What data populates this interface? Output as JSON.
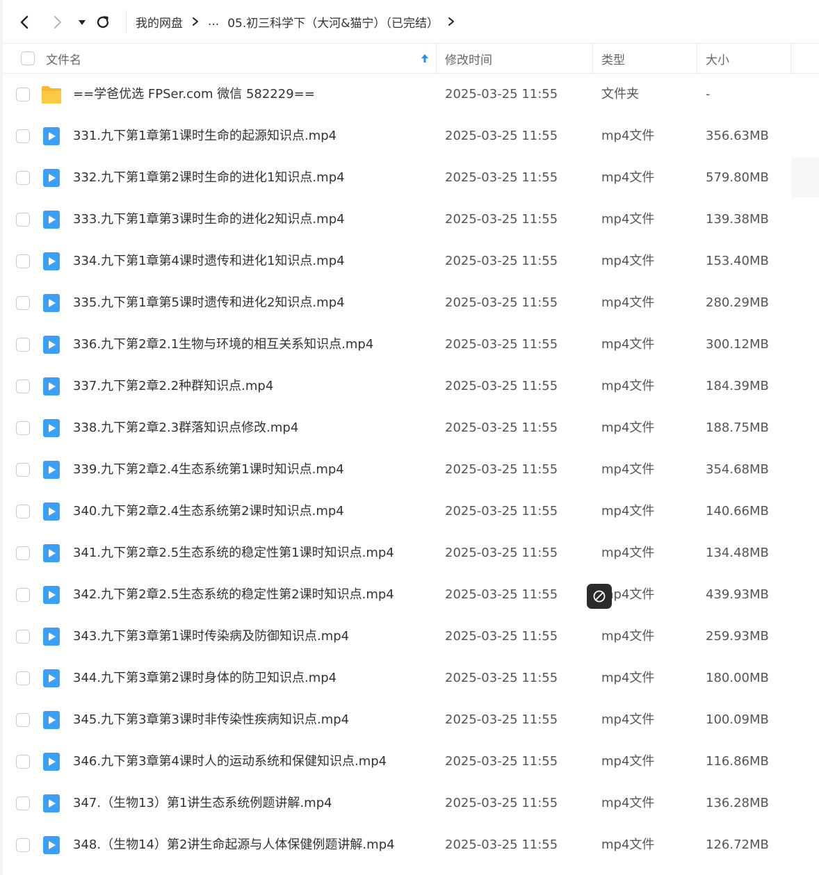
{
  "toolbar": {
    "back_icon": "chevron-left-icon",
    "forward_icon": "chevron-right-icon",
    "dropdown_icon": "caret-down-icon",
    "refresh_icon": "refresh-icon"
  },
  "breadcrumb": {
    "root": "我的网盘",
    "ellipsis": "...",
    "current": "05.初三科学下（大河&猫宁）（已完结）"
  },
  "header": {
    "name": "文件名",
    "time": "修改时间",
    "type": "类型",
    "size": "大小",
    "sort_icon": "arrow-up-icon"
  },
  "colors": {
    "accent": "#1e90ff",
    "folder": "#fbc53e",
    "video": "#3aa0f5"
  },
  "files": [
    {
      "name": "==学爸优选 FPSer.com 微信 582229==",
      "time": "2025-03-25 11:55",
      "type": "文件夹",
      "size": "-",
      "icon": "folder-icon"
    },
    {
      "name": "331.九下第1章第1课时生命的起源知识点.mp4",
      "time": "2025-03-25 11:55",
      "type": "mp4文件",
      "size": "356.63MB",
      "icon": "video-file-icon"
    },
    {
      "name": "332.九下第1章第2课时生命的进化1知识点.mp4",
      "time": "2025-03-25 11:55",
      "type": "mp4文件",
      "size": "579.80MB",
      "icon": "video-file-icon"
    },
    {
      "name": "333.九下第1章第3课时生命的进化2知识点.mp4",
      "time": "2025-03-25 11:55",
      "type": "mp4文件",
      "size": "139.38MB",
      "icon": "video-file-icon"
    },
    {
      "name": "334.九下第1章第4课时遗传和进化1知识点.mp4",
      "time": "2025-03-25 11:55",
      "type": "mp4文件",
      "size": "153.40MB",
      "icon": "video-file-icon"
    },
    {
      "name": "335.九下第1章第5课时遗传和进化2知识点.mp4",
      "time": "2025-03-25 11:55",
      "type": "mp4文件",
      "size": "280.29MB",
      "icon": "video-file-icon"
    },
    {
      "name": "336.九下第2章2.1生物与环境的相互关系知识点.mp4",
      "time": "2025-03-25 11:55",
      "type": "mp4文件",
      "size": "300.12MB",
      "icon": "video-file-icon"
    },
    {
      "name": "337.九下第2章2.2种群知识点.mp4",
      "time": "2025-03-25 11:55",
      "type": "mp4文件",
      "size": "184.39MB",
      "icon": "video-file-icon"
    },
    {
      "name": "338.九下第2章2.3群落知识点修改.mp4",
      "time": "2025-03-25 11:55",
      "type": "mp4文件",
      "size": "188.75MB",
      "icon": "video-file-icon"
    },
    {
      "name": "339.九下第2章2.4生态系统第1课时知识点.mp4",
      "time": "2025-03-25 11:55",
      "type": "mp4文件",
      "size": "354.68MB",
      "icon": "video-file-icon"
    },
    {
      "name": "340.九下第2章2.4生态系统第2课时知识点.mp4",
      "time": "2025-03-25 11:55",
      "type": "mp4文件",
      "size": "140.66MB",
      "icon": "video-file-icon"
    },
    {
      "name": "341.九下第2章2.5生态系统的稳定性第1课时知识点.mp4",
      "time": "2025-03-25 11:55",
      "type": "mp4文件",
      "size": "134.48MB",
      "icon": "video-file-icon"
    },
    {
      "name": "342.九下第2章2.5生态系统的稳定性第2课时知识点.mp4",
      "time": "2025-03-25 11:55",
      "type": "mp4文件",
      "size": "439.93MB",
      "icon": "video-file-icon"
    },
    {
      "name": "343.九下第3章第1课时传染病及防御知识点.mp4",
      "time": "2025-03-25 11:55",
      "type": "mp4文件",
      "size": "259.93MB",
      "icon": "video-file-icon"
    },
    {
      "name": "344.九下第3章第2课时身体的防卫知识点.mp4",
      "time": "2025-03-25 11:55",
      "type": "mp4文件",
      "size": "180.00MB",
      "icon": "video-file-icon"
    },
    {
      "name": "345.九下第3章第3课时非传染性疾病知识点.mp4",
      "time": "2025-03-25 11:55",
      "type": "mp4文件",
      "size": "100.09MB",
      "icon": "video-file-icon"
    },
    {
      "name": "346.九下第3章第4课时人的运动系统和保健知识点.mp4",
      "time": "2025-03-25 11:55",
      "type": "mp4文件",
      "size": "116.86MB",
      "icon": "video-file-icon"
    },
    {
      "name": "347.（生物13）第1讲生态系统例题讲解.mp4",
      "time": "2025-03-25 11:55",
      "type": "mp4文件",
      "size": "136.28MB",
      "icon": "video-file-icon"
    },
    {
      "name": "348.（生物14）第2讲生命起源与人体保健例题讲解.mp4",
      "time": "2025-03-25 11:55",
      "type": "mp4文件",
      "size": "126.72MB",
      "icon": "video-file-icon"
    }
  ],
  "overlay": {
    "icon": "no-entry-icon"
  }
}
